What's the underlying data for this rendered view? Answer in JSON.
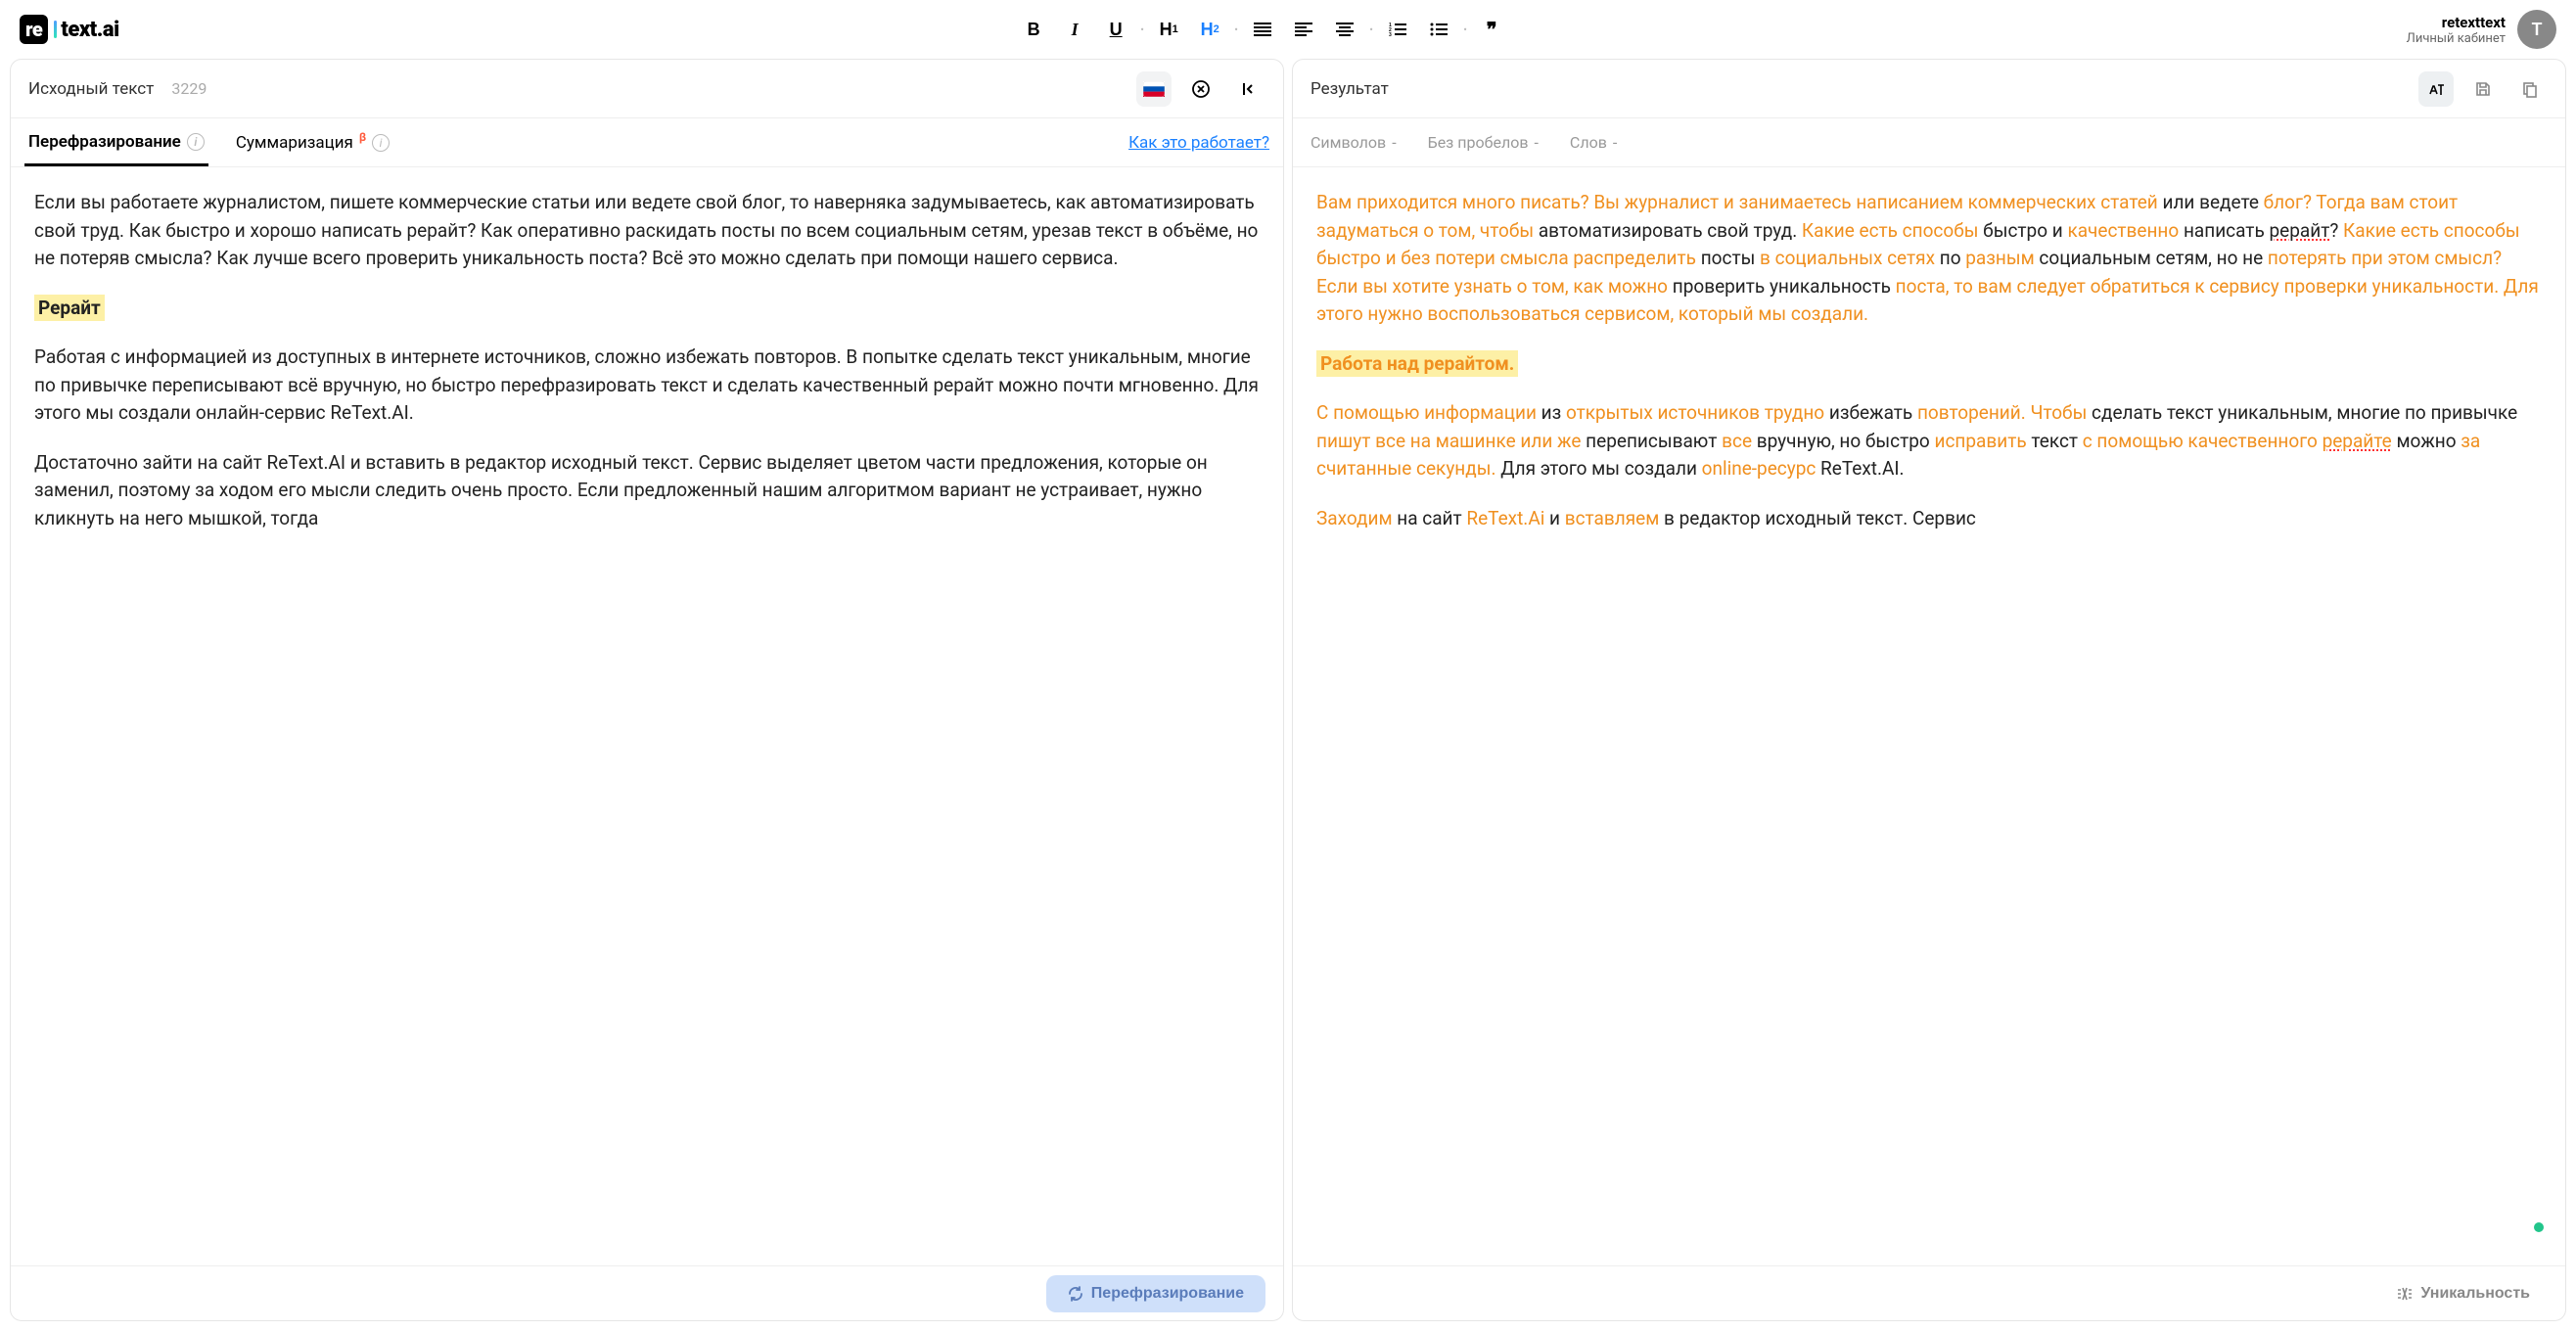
{
  "logo": {
    "badge": "re",
    "rest": "text.ai"
  },
  "user": {
    "name": "retexttext",
    "sub": "Личный кабинет",
    "initial": "T"
  },
  "toolbar": {
    "bold": "B",
    "italic": "I",
    "underline": "U",
    "h1a": "H",
    "h1b": "1",
    "h2a": "H",
    "h2b": "2",
    "quote": "❞"
  },
  "left": {
    "title": "Исходный текст",
    "count": "3229",
    "tabs": {
      "paraphrase": "Перефразирование",
      "summary": "Суммаризация",
      "beta": "β"
    },
    "how": "Как это работает?",
    "p1": "Если вы работаете журналистом, пишете коммерческие статьи или ведете свой блог, то наверняка задумываетесь, как автоматизировать свой труд. Как быстро и хорошо написать рерайт? Как оперативно раскидать посты по всем социальным сетям, урезав текст в объёме, но не потеряв смысла? Как лучше всего проверить уникальность поста? Всё это можно сделать при помощи нашего сервиса.",
    "h1": "Рерайт",
    "p2": "Работая с информацией из доступных в интернете источников, сложно избежать повторов. В попытке сделать текст уникальным, многие по привычке переписывают всё вручную, но быстро перефразировать текст и сделать качественный рерайт можно почти мгновенно. Для этого мы создали онлайн-сервис ReText.AI.",
    "p3": "Достаточно зайти на сайт ReText.AI и вставить в редактор исходный текст. Сервис выделяет цветом части предложения, которые он заменил, поэтому за ходом его мысли следить очень просто. Если предложенный нашим алгоритмом вариант не устраивает, нужно кликнуть на него мышкой, тогда",
    "btn": "Перефразирование"
  },
  "right": {
    "title": "Результат",
    "stats": {
      "chars": "Символов",
      "nospaces": "Без пробелов",
      "words": "Слов",
      "dash": "-"
    },
    "para1": {
      "s1": "Вам приходится много писать? Вы журналист и занимаетесь написанием коммерческих статей",
      "s2": " или ведете ",
      "s3": "блог? Тогда вам стоит задуматься о том, чтобы",
      "s4": " автоматизировать свой труд. ",
      "s5": "Какие есть способы",
      "s6": " быстро и ",
      "s7": "качественно",
      "s8": " написать ",
      "s9": "рерайт",
      "s10": "? ",
      "s11": "Какие есть способы быстро и без потери смысла распределить",
      "s12": " посты ",
      "s13": "в социальных сетях",
      "s14": " по ",
      "s15": "разным",
      "s16": " социальным сетям, но не ",
      "s17": "потерять при этом смысл? Если вы хотите узнать о том, как можно",
      "s18": " проверить уникальность ",
      "s19": "поста, то вам следует обратиться к сервису проверки уникальности. Для этого нужно воспользоваться сервисом, который мы создали."
    },
    "h1": "Работа над рерайтом.",
    "para2": {
      "s1": "С помощью информации",
      "s2": " из ",
      "s3": "открытых источников трудно",
      "s4": " избежать ",
      "s5": "повторений. Чтобы",
      "s6": " сделать текст уникальным, многие по привычке ",
      "s7": "пишут все на машинке или же",
      "s8": " переписывают ",
      "s9": "все",
      "s10": " вручную, но быстро ",
      "s11": "исправить",
      "s12": " текст ",
      "s13": "с помощью качественного ",
      "s14": "рерайте",
      "s15": " можно ",
      "s16": "за считанные секунды.",
      "s17": " Для этого мы создали ",
      "s18": "online-ресурс",
      "s19": " ReText.AI."
    },
    "para3": {
      "s1": "Заходим",
      "s2": " на сайт ",
      "s3": "ReText.Ai",
      "s4": " и ",
      "s5": "вставляем",
      "s6": " в редактор исходный текст. Сервис"
    },
    "btn": "Уникальность"
  }
}
